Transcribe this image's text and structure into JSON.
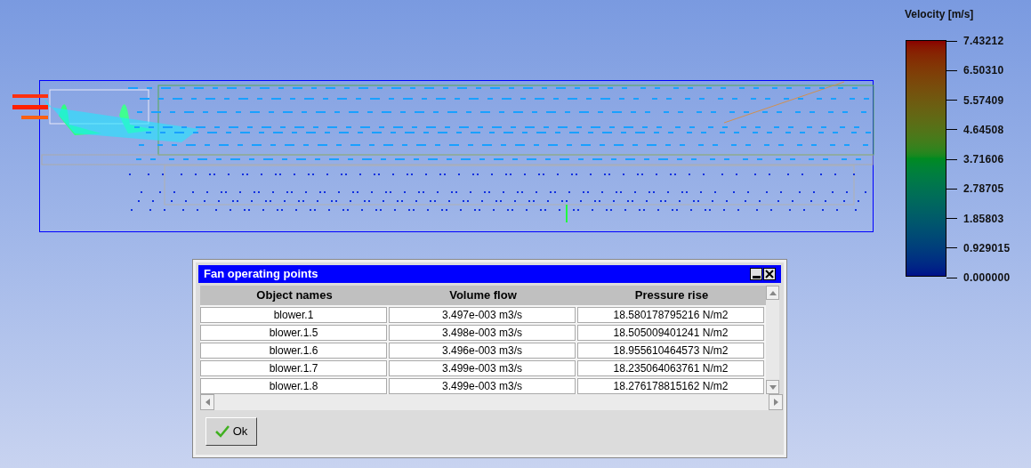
{
  "legend": {
    "title": "Velocity [m/s]",
    "ticks": [
      "7.43212",
      "6.50310",
      "5.57409",
      "4.64508",
      "3.71606",
      "2.78705",
      "1.85803",
      "0.929015",
      "0.000000"
    ]
  },
  "dialog": {
    "title": "Fan operating points",
    "table": {
      "columns": [
        "Object names",
        "Volume flow",
        "Pressure rise"
      ],
      "rows": [
        [
          "blower.1",
          "3.497e-003 m3/s",
          "18.580178795216 N/m2"
        ],
        [
          "blower.1.5",
          "3.498e-003 m3/s",
          "18.505009401241 N/m2"
        ],
        [
          "blower.1.6",
          "3.496e-003 m3/s",
          "18.955610464573 N/m2"
        ],
        [
          "blower.1.7",
          "3.499e-003 m3/s",
          "18.235064063761 N/m2"
        ],
        [
          "blower.1.8",
          "3.499e-003 m3/s",
          "18.276178815162 N/m2"
        ]
      ]
    },
    "buttons": [
      "Ok"
    ]
  }
}
